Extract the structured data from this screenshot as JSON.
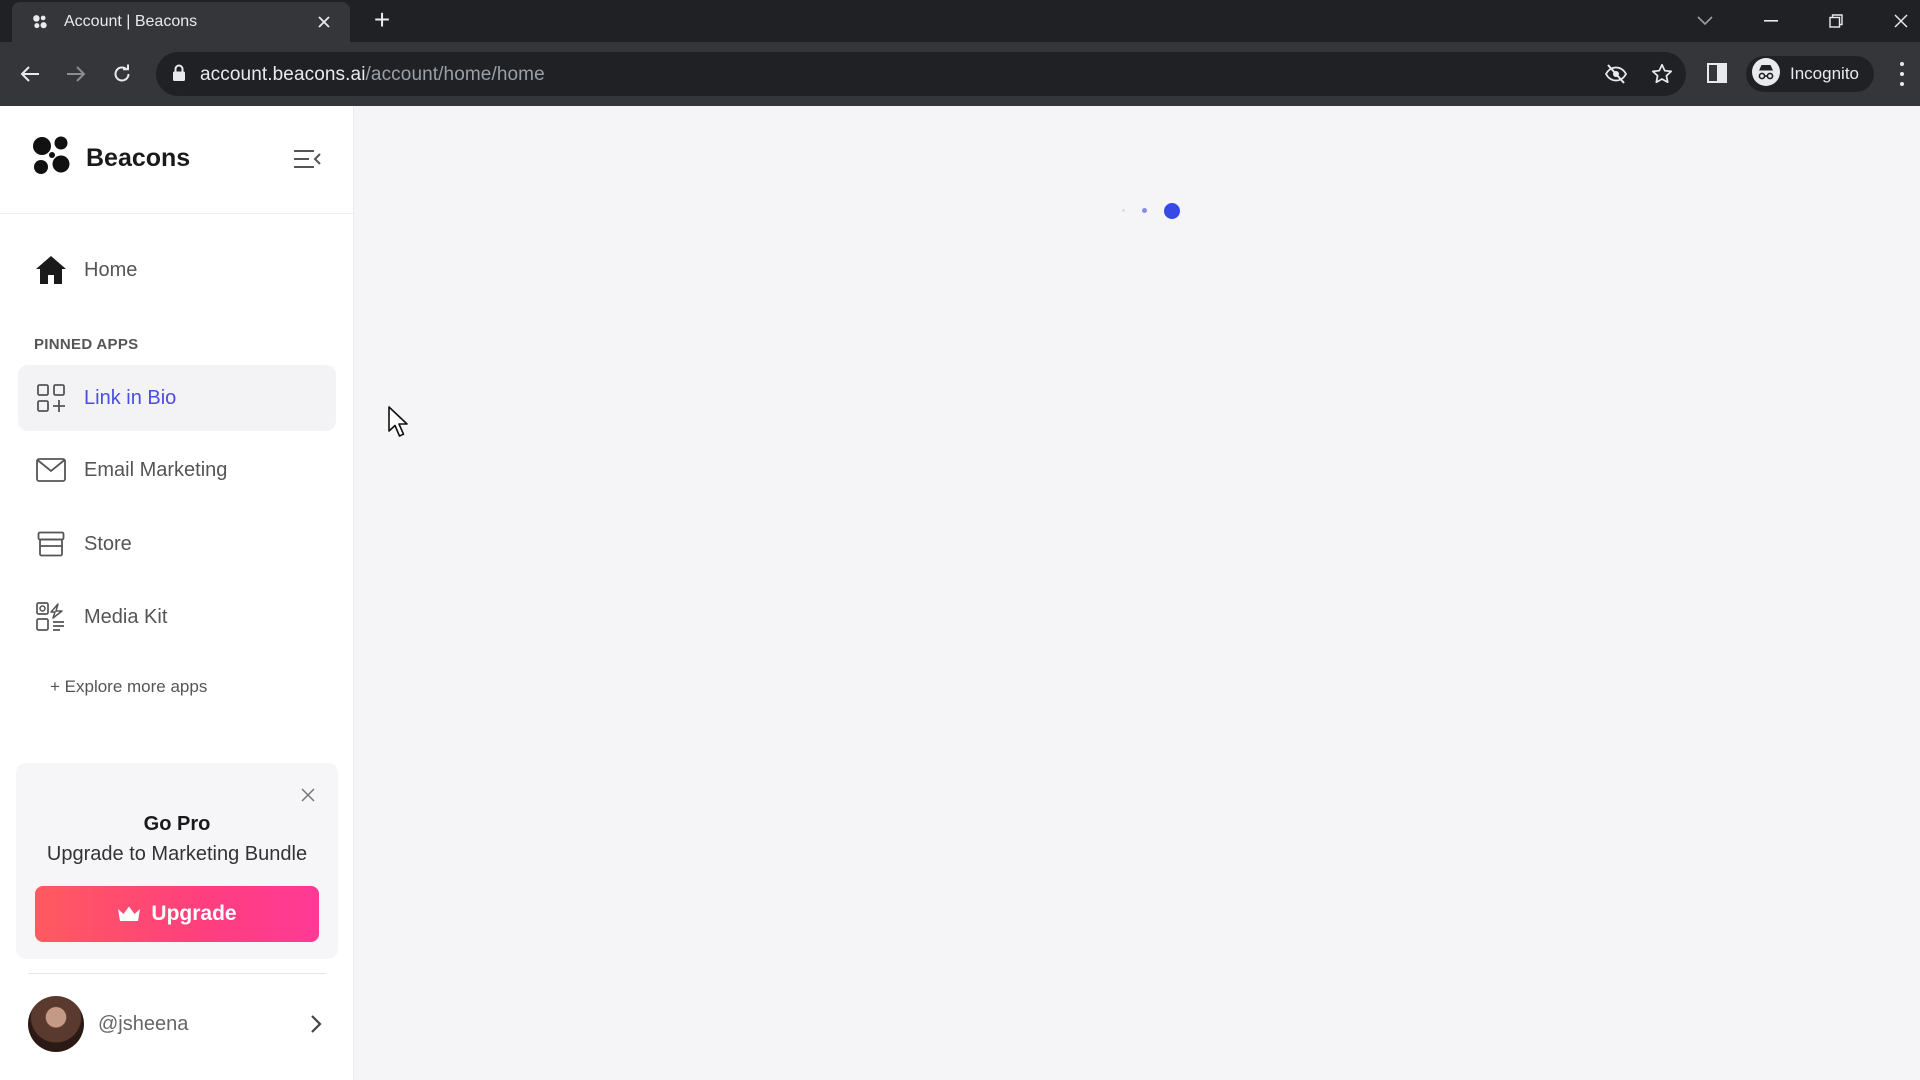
{
  "browser": {
    "tab_title": "Account | Beacons",
    "new_tab_symbol": "+",
    "url_host": "account.beacons.ai",
    "url_path": "/account/home/home",
    "profile_label": "Incognito"
  },
  "sidebar": {
    "brand_name": "Beacons",
    "home_label": "Home",
    "pinned_heading": "PINNED APPS",
    "pinned_items": [
      {
        "label": "Link in Bio",
        "icon": "grid-plus-icon",
        "active": true
      },
      {
        "label": "Email Marketing",
        "icon": "envelope-icon",
        "active": false
      },
      {
        "label": "Store",
        "icon": "storefront-icon",
        "active": false
      },
      {
        "label": "Media Kit",
        "icon": "media-kit-icon",
        "active": false
      }
    ],
    "explore_label": "+ Explore more apps",
    "promo": {
      "title": "Go Pro",
      "subtitle": "Upgrade to Marketing Bundle",
      "button_label": "Upgrade"
    },
    "user": {
      "handle": "@jsheena"
    }
  },
  "colors": {
    "accent": "#4a4ee0",
    "loader": "#3949e5",
    "upgrade_gradient_start": "#ff5a5f",
    "upgrade_gradient_end": "#ff3a96",
    "chrome_dark": "#202124",
    "chrome_toolbar": "#35363a"
  }
}
